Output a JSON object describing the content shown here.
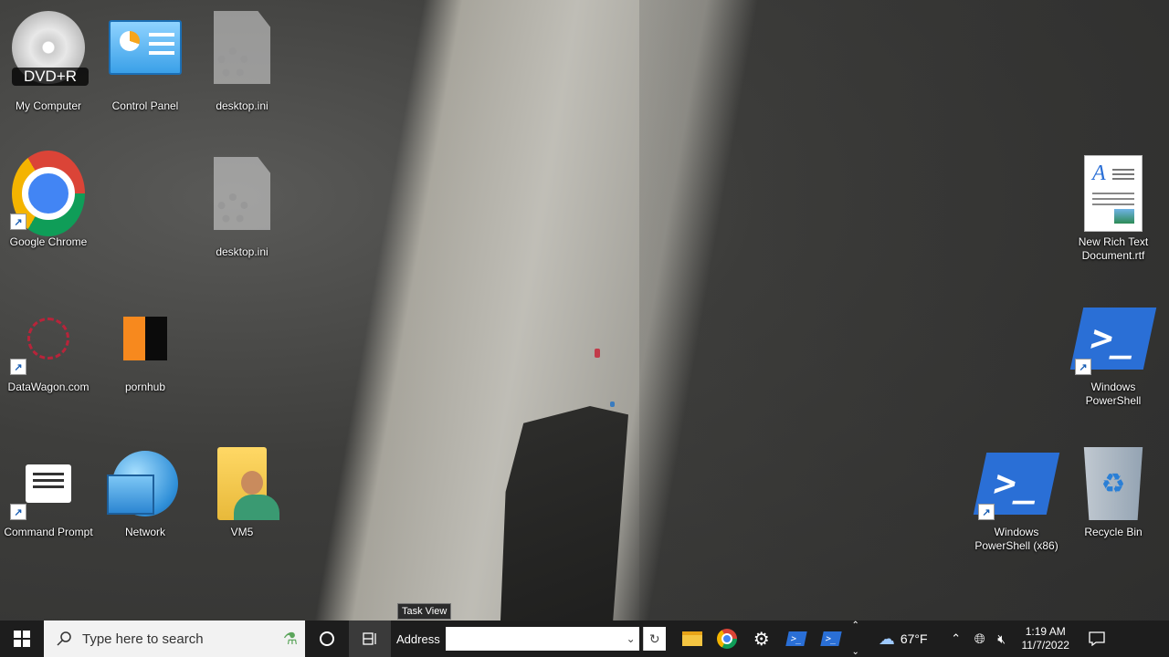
{
  "desktop": {
    "icons": [
      {
        "label": "My Computer",
        "badge": "DVD+R"
      },
      {
        "label": "Control Panel"
      },
      {
        "label": "desktop.ini"
      },
      {
        "label": "Google Chrome"
      },
      {
        "label": "desktop.ini"
      },
      {
        "label": "New Rich Text Document.rtf"
      },
      {
        "label": "DataWagon.com"
      },
      {
        "label": "pornhub"
      },
      {
        "label": "Windows PowerShell"
      },
      {
        "label": "Command Prompt"
      },
      {
        "label": "Network"
      },
      {
        "label": "VM5"
      },
      {
        "label": "Windows PowerShell (x86)"
      },
      {
        "label": "Recycle Bin"
      }
    ]
  },
  "taskbar": {
    "search_placeholder": "Type here to search",
    "task_view_tooltip": "Task View",
    "address_label": "Address",
    "address_value": "",
    "weather_temp": "67°F",
    "clock_time": "1:19 AM",
    "clock_date": "11/7/2022"
  },
  "colors": {
    "taskbar_bg": "#1d1d1d",
    "accent_blue": "#2a6fd6"
  }
}
